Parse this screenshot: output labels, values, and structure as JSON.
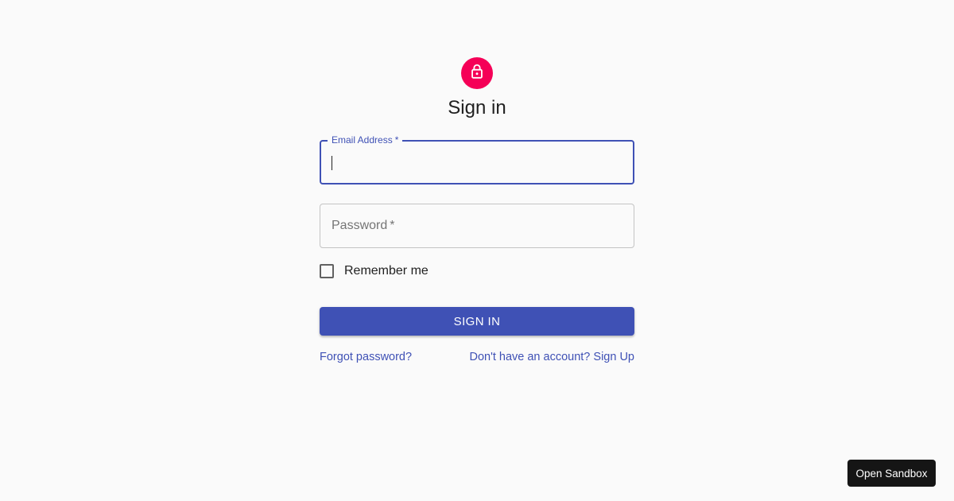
{
  "colors": {
    "primary": "#3f51b5",
    "secondary": "#f50057",
    "background": "#fafafa",
    "sandbox_button": "#151515"
  },
  "header": {
    "icon": "lock-open-icon",
    "title": "Sign in"
  },
  "form": {
    "email": {
      "label": "Email Address",
      "required_mark": "*",
      "value": "",
      "focused": true
    },
    "password": {
      "label": "Password",
      "required_mark": "*",
      "value": ""
    },
    "remember": {
      "label": "Remember me",
      "checked": false
    },
    "submit_label": "Sign In"
  },
  "links": {
    "forgot": "Forgot password?",
    "signup": "Don't have an account? Sign Up"
  },
  "sandbox": {
    "label": "Open Sandbox"
  }
}
